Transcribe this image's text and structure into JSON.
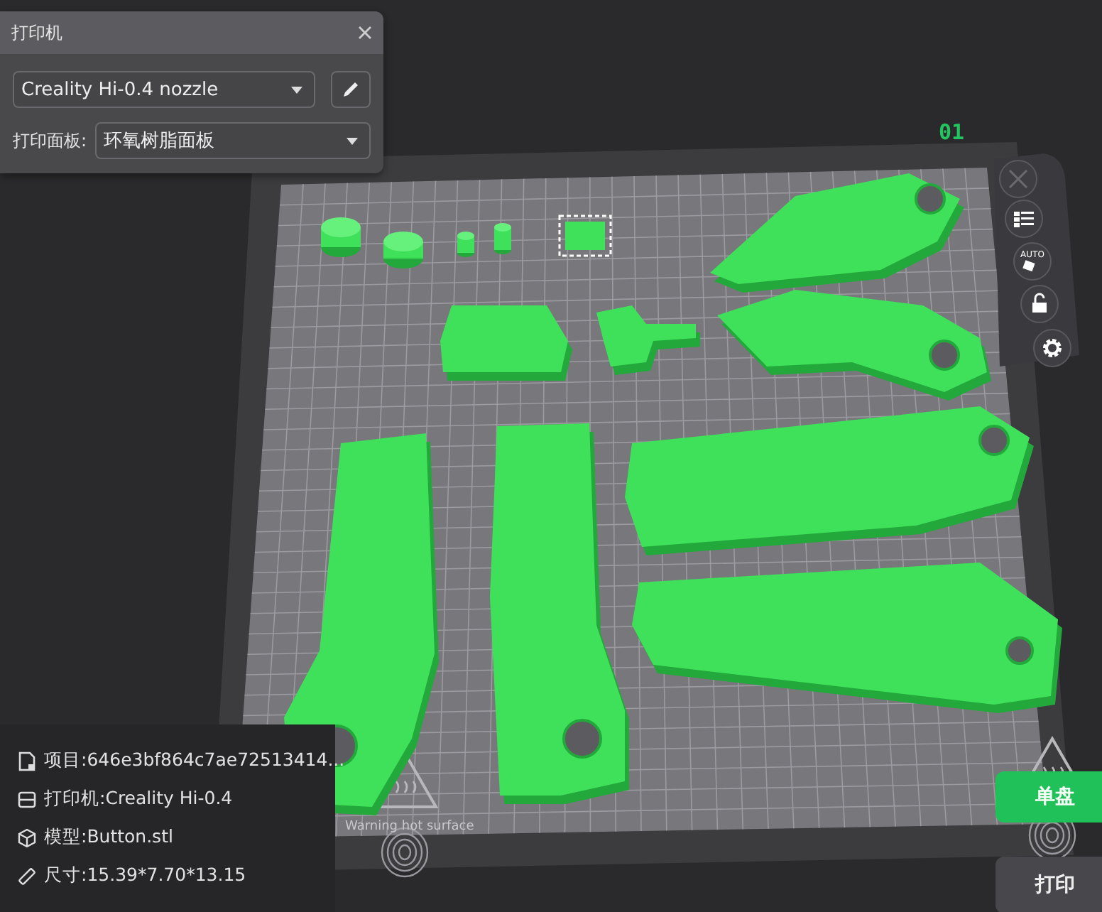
{
  "printer_panel": {
    "title": "打印机",
    "printer": "Creality Hi-0.4 nozzle",
    "plate_label": "打印面板:",
    "plate": "环氧树脂面板"
  },
  "plate_number": "01",
  "plate_tools": [
    {
      "kind": "close"
    },
    {
      "kind": "list"
    },
    {
      "kind": "auto",
      "label": "AUTO"
    },
    {
      "kind": "lock"
    },
    {
      "kind": "settings"
    }
  ],
  "bed": {
    "warning_text": "Warning hot surface"
  },
  "info": [
    {
      "kind": "project",
      "text": "项目:646e3bf864c7ae72513414..."
    },
    {
      "kind": "printer",
      "text": "打印机:Creality Hi-0.4"
    },
    {
      "kind": "model",
      "text": "模型:Button.stl"
    },
    {
      "kind": "size",
      "text": "尺寸:15.39*7.70*13.15"
    }
  ],
  "buttons": [
    {
      "kind": "primary",
      "label": "单盘"
    },
    {
      "kind": "secondary",
      "label": "打印"
    }
  ]
}
